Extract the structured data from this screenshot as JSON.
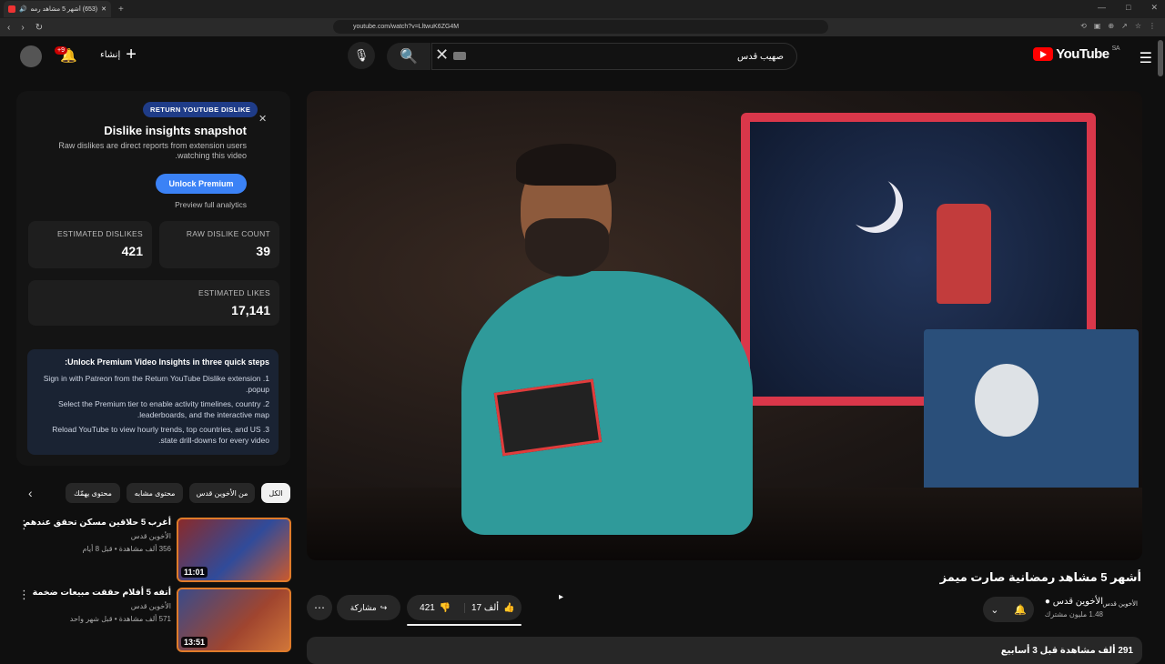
{
  "browser": {
    "tab_title": "(653) أشهر 5 مشاهد رمضانية",
    "url": "youtube.com/watch?v=LltwuK6ZG4M"
  },
  "header": {
    "logo_text": "YouTube",
    "region": "SA",
    "search_value": "صهيب قدس",
    "create_label": "إنشاء",
    "notifications_badge": "+9"
  },
  "dislike_panel": {
    "badge": "RETURN YOUTUBE DISLIKE",
    "title": "Dislike insights snapshot",
    "description": "Raw dislikes are direct reports from extension users watching this video.",
    "unlock_label": "Unlock Premium",
    "preview_label": "Preview full analytics",
    "estimated_dislikes_label": "ESTIMATED DISLIKES",
    "estimated_dislikes": "421",
    "raw_dislike_label": "RAW DISLIKE COUNT",
    "raw_dislike_count": "39",
    "estimated_likes_label": "ESTIMATED LIKES",
    "estimated_likes": "17,141",
    "steps_title": "Unlock Premium Video Insights in three quick steps:",
    "steps": [
      "1. Sign in with Patreon from the Return YouTube Dislike extension popup.",
      "2. Select the Premium tier to enable activity timelines, country leaderboards, and the interactive map.",
      "3. Reload YouTube to view hourly trends, top countries, and US state drill-downs for every video."
    ]
  },
  "chips": [
    "الكل",
    "من الأخوين قدس",
    "محتوى مشابه",
    "محتوى يهمّك"
  ],
  "recommendations": [
    {
      "title": "أغرب 5 حلاقين مسكن تحقق عندهم",
      "channel": "الأخوين قدس",
      "meta": "356 ألف مشاهدة • قبل 8 أيام",
      "duration": "11:01"
    },
    {
      "title": "أتفه 5 أفلام حققت مبيعات ضخمة",
      "channel": "الأخوين قدس",
      "meta": "571 ألف مشاهدة • قبل شهر واحد",
      "duration": "13:51"
    }
  ],
  "video": {
    "title": "أشهر 5 مشاهد رمضانية صارت ميمز",
    "channel": "الأخوين قدس",
    "subscribers": "1.48 مليون مشترك",
    "channel_logo_text": "الأخوين قدس",
    "likes": "17 ألف",
    "dislikes": "421",
    "share_label": "مشاركة",
    "description_head": "291 ألف مشاهدة قبل 3 أسابيع"
  }
}
